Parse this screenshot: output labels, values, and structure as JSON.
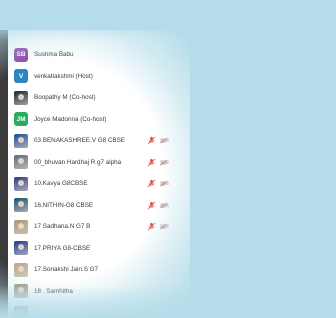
{
  "colors": {
    "background": "#b5dde9",
    "muted_red": "#e05050",
    "text": "#3a3a3a"
  },
  "participants": [
    {
      "name": "Sushma Babu",
      "initials": "SB",
      "avatar_type": "initials",
      "avatar_color": "#8e44ad",
      "mic_off": false,
      "cam_off": false
    },
    {
      "name": "venkatlakshmi (Host)",
      "initials": "V",
      "avatar_type": "initials",
      "avatar_color": "#2e86c1",
      "mic_off": false,
      "cam_off": false
    },
    {
      "name": "Boopathy M (Co-host)",
      "initials": "",
      "avatar_type": "photo",
      "avatar_color": "#1c2833",
      "mic_off": false,
      "cam_off": false
    },
    {
      "name": "Joyce Madonna (Co-host)",
      "initials": "JM",
      "avatar_type": "initials",
      "avatar_color": "#27ae60",
      "mic_off": false,
      "cam_off": false
    },
    {
      "name": "03 BENAKASHREE.V G8 CBSE",
      "initials": "",
      "avatar_type": "photo",
      "avatar_color": "#1f4e9c",
      "mic_off": true,
      "cam_off": true
    },
    {
      "name": "0\u0000_bhuvan Hardhaj R  g7 alpha",
      "initials": "",
      "avatar_type": "photo",
      "avatar_color": "#5d6d7e",
      "mic_off": true,
      "cam_off": true
    },
    {
      "name": "10.Kavya G8CBSE",
      "initials": "",
      "avatar_type": "photo",
      "avatar_color": "#2c3e8c",
      "mic_off": true,
      "cam_off": true
    },
    {
      "name": "16.NITHIN-G8 CBSE",
      "initials": "",
      "avatar_type": "photo",
      "avatar_color": "#1a5276",
      "mic_off": true,
      "cam_off": true
    },
    {
      "name": "17 Sadhana.N G7 B",
      "initials": "",
      "avatar_type": "photo",
      "avatar_color": "#a9977a",
      "mic_off": true,
      "cam_off": true
    },
    {
      "name": "17.PRIYA G8-CBSE",
      "initials": "",
      "avatar_type": "photo",
      "avatar_color": "#1f3a93",
      "mic_off": false,
      "cam_off": false
    },
    {
      "name": "17.Sonakshi Jain.S G7",
      "initials": "",
      "avatar_type": "photo",
      "avatar_color": "#b9a98a",
      "mic_off": false,
      "cam_off": false
    },
    {
      "name": "18 . Samhitha",
      "initials": "",
      "avatar_type": "photo",
      "avatar_color": "#9c8f7d",
      "mic_off": false,
      "cam_off": false
    },
    {
      "name": "",
      "initials": "",
      "avatar_type": "photo",
      "avatar_color": "#8a8f9a",
      "mic_off": false,
      "cam_off": false
    }
  ]
}
